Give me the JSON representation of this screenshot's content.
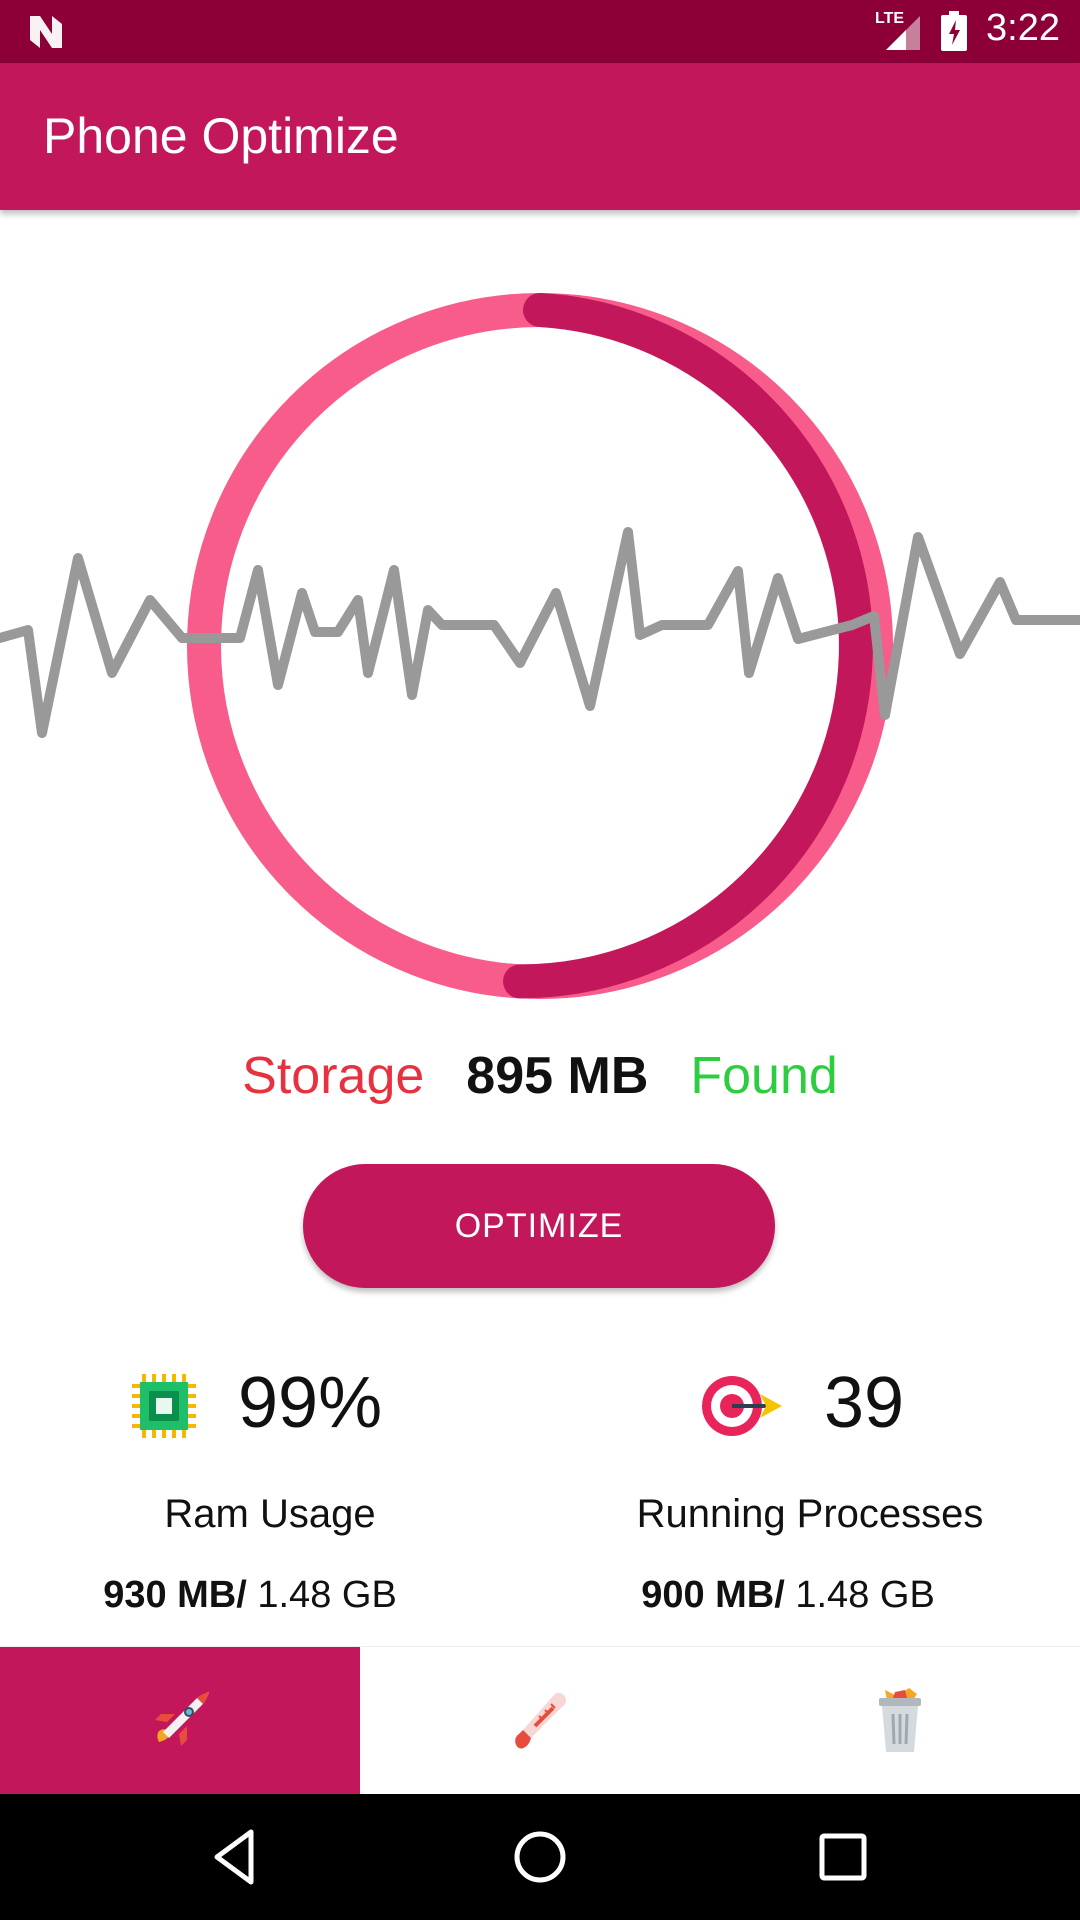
{
  "status_bar": {
    "network": "LTE",
    "time": "3:22"
  },
  "app_bar": {
    "title": "Phone Optimize"
  },
  "storage": {
    "label": "Storage",
    "value": "895 MB",
    "status": "Found"
  },
  "optimize_button": {
    "label": "OPTIMIZE"
  },
  "stats": {
    "ram": {
      "value": "99%",
      "label": "Ram Usage",
      "used": "930 MB/",
      "total": " 1.48 GB"
    },
    "processes": {
      "value": "39",
      "label": "Running Processes",
      "used": "900 MB/",
      "total": " 1.48 GB"
    }
  },
  "bottom_nav": {
    "tabs": [
      {
        "icon": "rocket-icon",
        "active": true
      },
      {
        "icon": "thermometer-icon",
        "active": false
      },
      {
        "icon": "trash-icon",
        "active": false
      }
    ]
  },
  "colors": {
    "primary": "#c2185b",
    "primary_dark": "#8c0037",
    "ring_light": "#f75c8b",
    "wave": "#999999",
    "storage_label": "#e8313f",
    "found": "#2ecc40"
  }
}
